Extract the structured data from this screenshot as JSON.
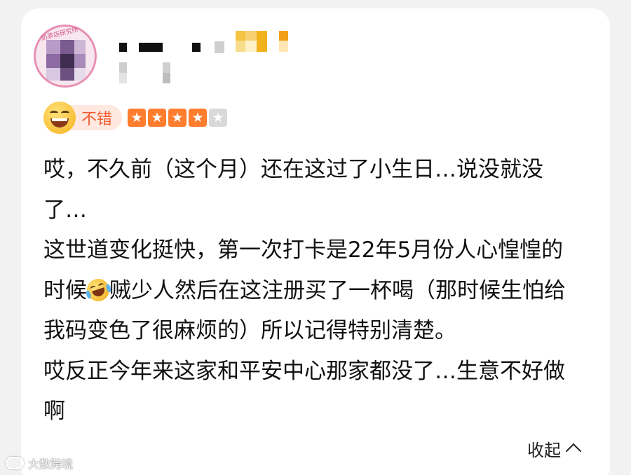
{
  "review": {
    "rating_label": "不错",
    "stars_filled": 4,
    "stars_total": 5,
    "paragraphs": [
      "哎，不久前（这个月）还在这过了小生日…说没就没了…",
      "这世道变化挺快，第一次打卡是22年5月份人心惶惶的时候",
      "贼少人然后在这注册买了一杯喝（那时候生怕给我码变色了很麻烦的）所以记得特别清楚。",
      "哎反正今年来这家和平安中心那家都没了…生意不好做啊"
    ],
    "collapse_label": "收起"
  },
  "avatar": {
    "ring_text": "奶茶店研究所"
  },
  "watermark": {
    "text": "大数跨境"
  },
  "icons": {
    "rating_emoji": "grinning-face-icon",
    "inline_emoji": "rolling-on-floor-laughing-icon",
    "collapse_chevron": "chevron-up-icon",
    "star": "star-icon"
  },
  "colors": {
    "accent": "#ef5a2e",
    "star_on": "#ff7d2e",
    "star_off": "#d9d9d9",
    "pill_bg": "#ffe8e0"
  }
}
